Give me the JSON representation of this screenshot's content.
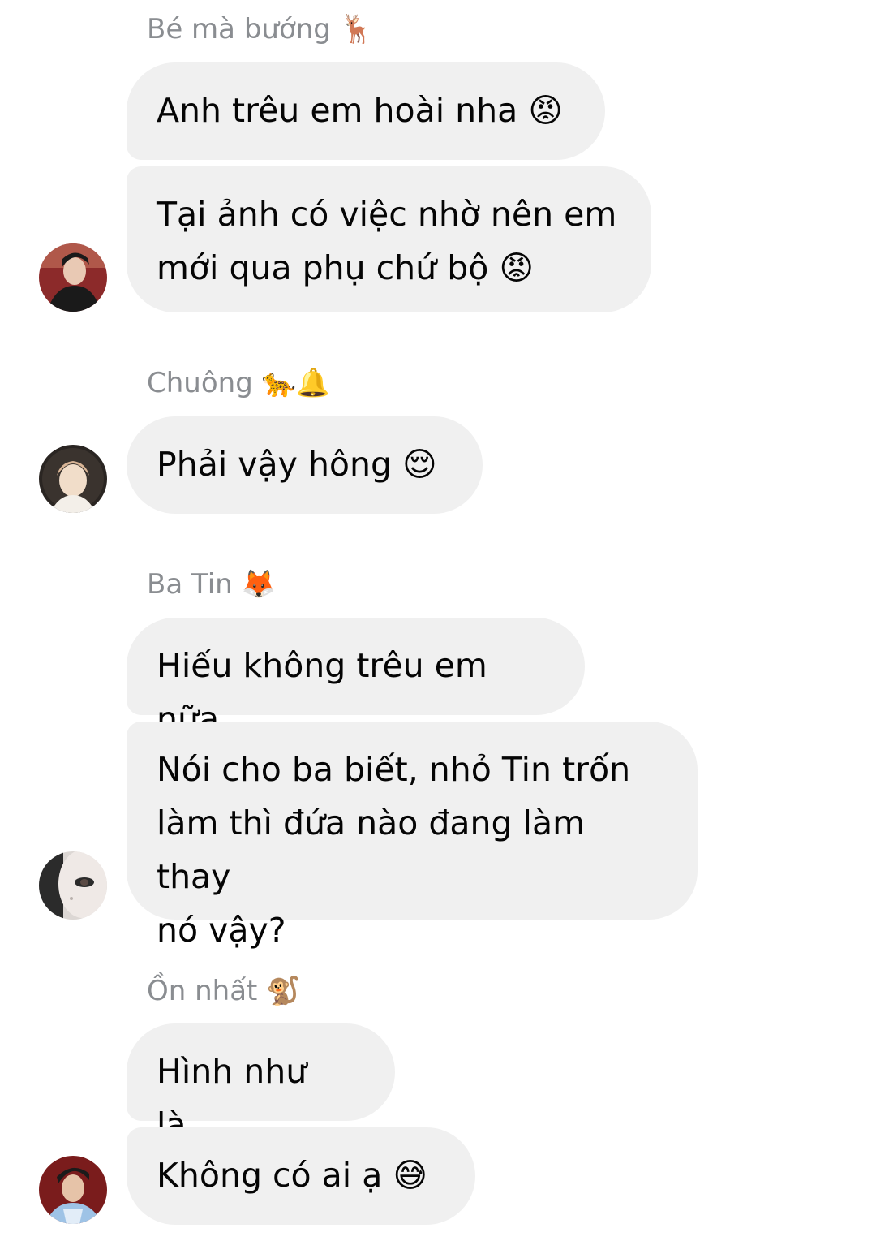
{
  "groups": [
    {
      "sender": "Bé mà bướng 🦌",
      "messages": [
        "Anh trêu em hoài nha 😡",
        "Tại ảnh có việc nhờ nên em\nmới qua phụ chứ bộ 😡"
      ],
      "avatar_colors": [
        "#8c2a2a",
        "#1a1a1a",
        "#e9c9b4"
      ]
    },
    {
      "sender": "Chuông 🐆🔔",
      "messages": [
        "Phải vậy hông 😌"
      ],
      "avatar_colors": [
        "#2a2522",
        "#f1ddc9",
        "#d9b596"
      ]
    },
    {
      "sender": "Ba Tin 🦊",
      "messages": [
        "Hiếu không trêu em nữa",
        "Nói cho ba biết, nhỏ Tin trốn\nlàm thì đứa nào đang làm thay\nnó vậy?"
      ],
      "avatar_colors": [
        "#dcd7d4",
        "#2b2b2b",
        "#b9b1ad"
      ]
    },
    {
      "sender": "Ồn nhất 🐒",
      "messages": [
        "Hình như là..",
        "Không có ai ạ 😅"
      ],
      "avatar_colors": [
        "#7a1c1c",
        "#9ec3e6",
        "#1b1b1b"
      ]
    }
  ]
}
